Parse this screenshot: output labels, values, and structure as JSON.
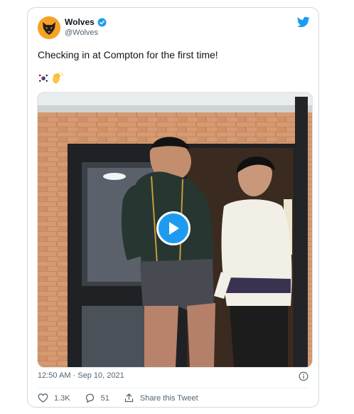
{
  "account": {
    "name": "Wolves",
    "handle": "@Wolves"
  },
  "tweet": {
    "text": "Checking in at Compton for the first time!",
    "emojis": [
      "flag-south-korea",
      "waving-hands"
    ]
  },
  "media": {
    "type": "video",
    "play_icon": "play-icon"
  },
  "meta": {
    "timestamp": "12:50 AM · Sep 10, 2021"
  },
  "actions": {
    "like_count": "1.3K",
    "reply_count": "51",
    "share_label": "Share this Tweet"
  },
  "colors": {
    "twitter_blue": "#1d9bf0",
    "wolves_gold": "#f6a324",
    "text_secondary": "#536471",
    "border": "#cfd9de"
  }
}
